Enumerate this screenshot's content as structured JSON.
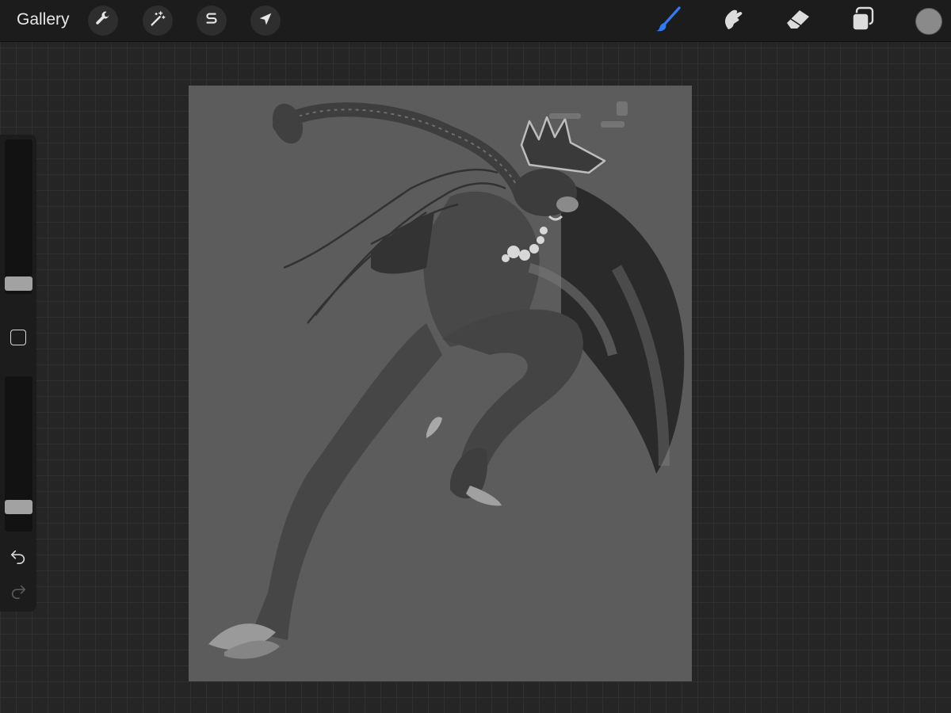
{
  "toolbar": {
    "gallery_label": "Gallery",
    "left_tools": [
      {
        "icon": "wrench-icon",
        "name": "actions"
      },
      {
        "icon": "magic-wand-icon",
        "name": "adjustments"
      },
      {
        "icon": "selection-s-icon",
        "name": "selection"
      },
      {
        "icon": "arrow-cursor-icon",
        "name": "transform"
      }
    ],
    "right_tools": [
      {
        "icon": "brush-icon",
        "name": "brush",
        "active": true,
        "color": "#2e7cf6"
      },
      {
        "icon": "smudge-icon",
        "name": "smudge",
        "active": false
      },
      {
        "icon": "eraser-icon",
        "name": "eraser",
        "active": false
      },
      {
        "icon": "layers-icon",
        "name": "layers",
        "active": false
      }
    ],
    "current_color": "#8a8a8a"
  },
  "sidebar": {
    "brush_size_level": 0.1,
    "opacity_level": 0.1,
    "modify_icon": "square-icon",
    "undo_icon": "undo-arrow-icon",
    "redo_icon": "redo-arrow-icon"
  },
  "canvas": {
    "background": "#5c5c5c",
    "artwork": "grayscale-boar-warrior-painting"
  }
}
